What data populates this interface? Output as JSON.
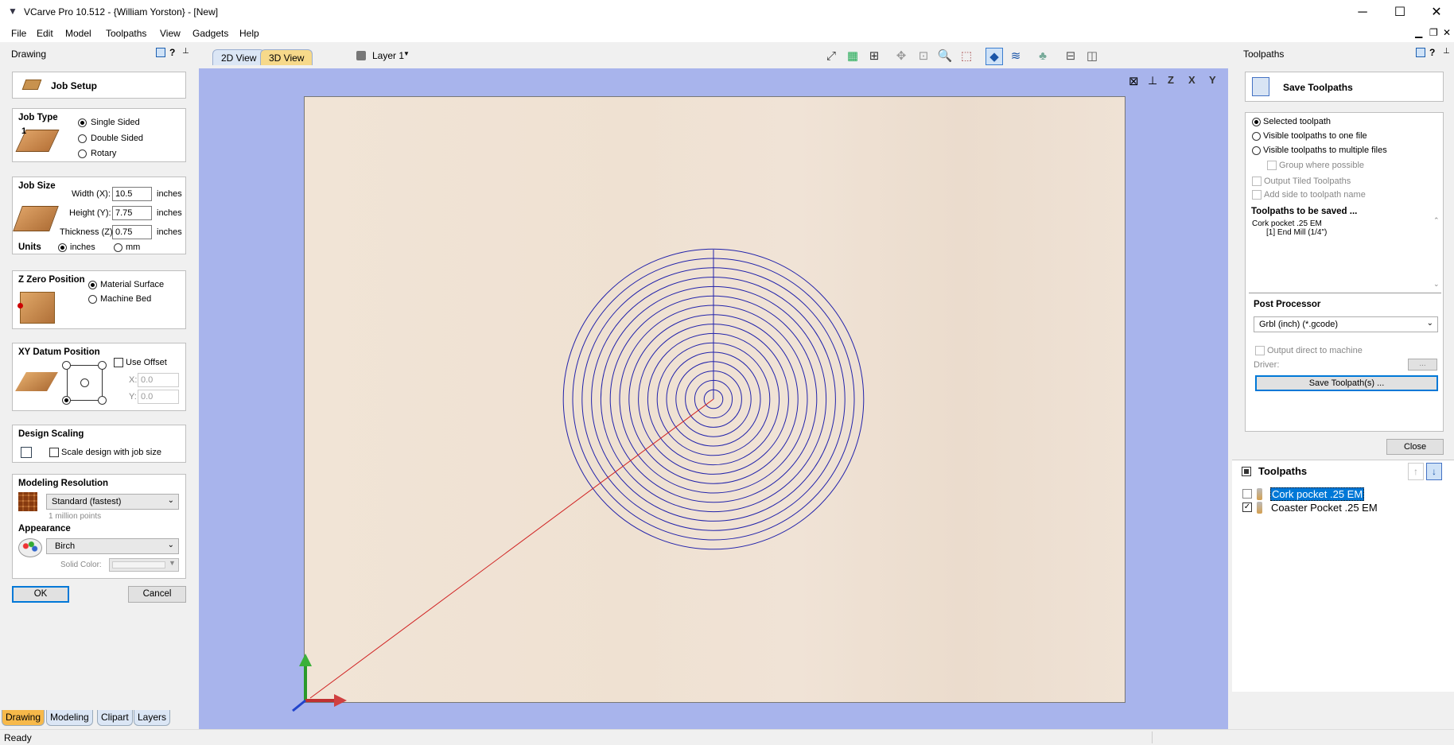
{
  "window": {
    "title": "VCarve Pro 10.512 - {William Yorston} - [New]",
    "minimize": "─",
    "maximize": "☐",
    "close": "✕"
  },
  "menu": [
    "File",
    "Edit",
    "Model",
    "Toolpaths",
    "View",
    "Gadgets",
    "Help"
  ],
  "left_panel": {
    "header": "Drawing",
    "header_icons": [
      "?",
      "📌"
    ],
    "job_setup_label": "Job Setup",
    "job_type": {
      "title": "Job Type",
      "options": [
        "Single Sided",
        "Double Sided",
        "Rotary"
      ],
      "selected": 0
    },
    "job_size": {
      "title": "Job Size",
      "width_label": "Width (X):",
      "width": "10.5",
      "height_label": "Height (Y):",
      "height": "7.75",
      "thickness_label": "Thickness (Z):",
      "thickness": "0.75",
      "unit": "inches",
      "units_label": "Units",
      "unit_options": [
        "inches",
        "mm"
      ]
    },
    "z_zero": {
      "title": "Z Zero Position",
      "options": [
        "Material Surface",
        "Machine Bed"
      ],
      "selected": 0
    },
    "xy_datum": {
      "title": "XY Datum Position",
      "use_offset": "Use Offset",
      "x_label": "X:",
      "x": "0.0",
      "y_label": "Y:",
      "y": "0.0"
    },
    "design_scaling": {
      "title": "Design Scaling",
      "checkbox": "Scale design with job size"
    },
    "modeling_resolution": {
      "title": "Modeling Resolution",
      "value": "Standard (fastest)",
      "note": "1 million points"
    },
    "appearance": {
      "title": "Appearance",
      "value": "Birch",
      "solid_color_label": "Solid Color:"
    },
    "ok": "OK",
    "cancel": "Cancel"
  },
  "bottom_tabs": [
    "Drawing",
    "Modeling",
    "Clipart",
    "Layers"
  ],
  "view_tabs": [
    "2D View",
    "3D View"
  ],
  "layer": "Layer 1",
  "axis_buttons": [
    "Z",
    "X",
    "Y"
  ],
  "right_panel": {
    "header": "Toolpaths",
    "header_icons": [
      "?",
      "📌"
    ],
    "save_title": "Save Toolpaths",
    "options": [
      "Selected toolpath",
      "Visible toolpaths to one file",
      "Visible toolpaths to multiple files"
    ],
    "selected_option": 0,
    "checkboxes": [
      "Group where possible",
      "Output Tiled Toolpaths",
      "Add side to toolpath name"
    ],
    "to_be_saved_label": "Toolpaths to be saved ...",
    "to_be_saved": [
      "Cork pocket .25 EM",
      "[1] End Mill (1/4\")"
    ],
    "post_processor_label": "Post Processor",
    "post_processor": "Grbl (inch) (*.gcode)",
    "output_direct": "Output direct to machine",
    "driver_label": "Driver:",
    "driver_btn": "...",
    "save_btn": "Save Toolpath(s) ...",
    "close_btn": "Close",
    "toolpaths_list_title": "Toolpaths",
    "toolpaths": [
      {
        "name": "Cork pocket .25 EM",
        "checked": false,
        "selected": true
      },
      {
        "name": "Coaster Pocket .25 EM",
        "checked": true,
        "selected": false
      }
    ]
  },
  "status": "Ready",
  "colors": {
    "viewport": "#a8b4ec",
    "toolpath": "#2222aa",
    "tab_active": "#f7b94a",
    "selection": "#0078d7"
  }
}
